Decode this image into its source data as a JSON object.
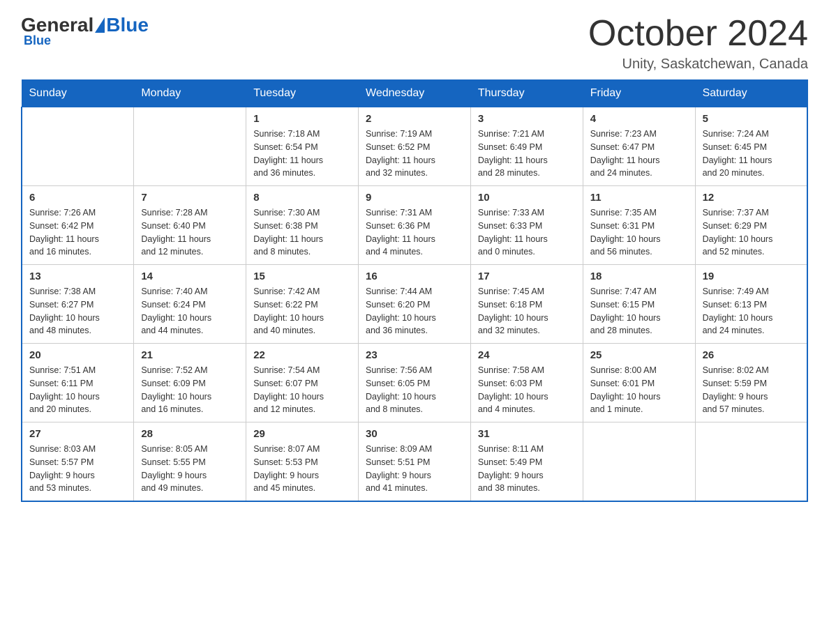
{
  "header": {
    "logo_general": "General",
    "logo_blue": "Blue",
    "month_title": "October 2024",
    "location": "Unity, Saskatchewan, Canada"
  },
  "days_of_week": [
    "Sunday",
    "Monday",
    "Tuesday",
    "Wednesday",
    "Thursday",
    "Friday",
    "Saturday"
  ],
  "weeks": [
    [
      {
        "num": "",
        "info": ""
      },
      {
        "num": "",
        "info": ""
      },
      {
        "num": "1",
        "info": "Sunrise: 7:18 AM\nSunset: 6:54 PM\nDaylight: 11 hours\nand 36 minutes."
      },
      {
        "num": "2",
        "info": "Sunrise: 7:19 AM\nSunset: 6:52 PM\nDaylight: 11 hours\nand 32 minutes."
      },
      {
        "num": "3",
        "info": "Sunrise: 7:21 AM\nSunset: 6:49 PM\nDaylight: 11 hours\nand 28 minutes."
      },
      {
        "num": "4",
        "info": "Sunrise: 7:23 AM\nSunset: 6:47 PM\nDaylight: 11 hours\nand 24 minutes."
      },
      {
        "num": "5",
        "info": "Sunrise: 7:24 AM\nSunset: 6:45 PM\nDaylight: 11 hours\nand 20 minutes."
      }
    ],
    [
      {
        "num": "6",
        "info": "Sunrise: 7:26 AM\nSunset: 6:42 PM\nDaylight: 11 hours\nand 16 minutes."
      },
      {
        "num": "7",
        "info": "Sunrise: 7:28 AM\nSunset: 6:40 PM\nDaylight: 11 hours\nand 12 minutes."
      },
      {
        "num": "8",
        "info": "Sunrise: 7:30 AM\nSunset: 6:38 PM\nDaylight: 11 hours\nand 8 minutes."
      },
      {
        "num": "9",
        "info": "Sunrise: 7:31 AM\nSunset: 6:36 PM\nDaylight: 11 hours\nand 4 minutes."
      },
      {
        "num": "10",
        "info": "Sunrise: 7:33 AM\nSunset: 6:33 PM\nDaylight: 11 hours\nand 0 minutes."
      },
      {
        "num": "11",
        "info": "Sunrise: 7:35 AM\nSunset: 6:31 PM\nDaylight: 10 hours\nand 56 minutes."
      },
      {
        "num": "12",
        "info": "Sunrise: 7:37 AM\nSunset: 6:29 PM\nDaylight: 10 hours\nand 52 minutes."
      }
    ],
    [
      {
        "num": "13",
        "info": "Sunrise: 7:38 AM\nSunset: 6:27 PM\nDaylight: 10 hours\nand 48 minutes."
      },
      {
        "num": "14",
        "info": "Sunrise: 7:40 AM\nSunset: 6:24 PM\nDaylight: 10 hours\nand 44 minutes."
      },
      {
        "num": "15",
        "info": "Sunrise: 7:42 AM\nSunset: 6:22 PM\nDaylight: 10 hours\nand 40 minutes."
      },
      {
        "num": "16",
        "info": "Sunrise: 7:44 AM\nSunset: 6:20 PM\nDaylight: 10 hours\nand 36 minutes."
      },
      {
        "num": "17",
        "info": "Sunrise: 7:45 AM\nSunset: 6:18 PM\nDaylight: 10 hours\nand 32 minutes."
      },
      {
        "num": "18",
        "info": "Sunrise: 7:47 AM\nSunset: 6:15 PM\nDaylight: 10 hours\nand 28 minutes."
      },
      {
        "num": "19",
        "info": "Sunrise: 7:49 AM\nSunset: 6:13 PM\nDaylight: 10 hours\nand 24 minutes."
      }
    ],
    [
      {
        "num": "20",
        "info": "Sunrise: 7:51 AM\nSunset: 6:11 PM\nDaylight: 10 hours\nand 20 minutes."
      },
      {
        "num": "21",
        "info": "Sunrise: 7:52 AM\nSunset: 6:09 PM\nDaylight: 10 hours\nand 16 minutes."
      },
      {
        "num": "22",
        "info": "Sunrise: 7:54 AM\nSunset: 6:07 PM\nDaylight: 10 hours\nand 12 minutes."
      },
      {
        "num": "23",
        "info": "Sunrise: 7:56 AM\nSunset: 6:05 PM\nDaylight: 10 hours\nand 8 minutes."
      },
      {
        "num": "24",
        "info": "Sunrise: 7:58 AM\nSunset: 6:03 PM\nDaylight: 10 hours\nand 4 minutes."
      },
      {
        "num": "25",
        "info": "Sunrise: 8:00 AM\nSunset: 6:01 PM\nDaylight: 10 hours\nand 1 minute."
      },
      {
        "num": "26",
        "info": "Sunrise: 8:02 AM\nSunset: 5:59 PM\nDaylight: 9 hours\nand 57 minutes."
      }
    ],
    [
      {
        "num": "27",
        "info": "Sunrise: 8:03 AM\nSunset: 5:57 PM\nDaylight: 9 hours\nand 53 minutes."
      },
      {
        "num": "28",
        "info": "Sunrise: 8:05 AM\nSunset: 5:55 PM\nDaylight: 9 hours\nand 49 minutes."
      },
      {
        "num": "29",
        "info": "Sunrise: 8:07 AM\nSunset: 5:53 PM\nDaylight: 9 hours\nand 45 minutes."
      },
      {
        "num": "30",
        "info": "Sunrise: 8:09 AM\nSunset: 5:51 PM\nDaylight: 9 hours\nand 41 minutes."
      },
      {
        "num": "31",
        "info": "Sunrise: 8:11 AM\nSunset: 5:49 PM\nDaylight: 9 hours\nand 38 minutes."
      },
      {
        "num": "",
        "info": ""
      },
      {
        "num": "",
        "info": ""
      }
    ]
  ]
}
